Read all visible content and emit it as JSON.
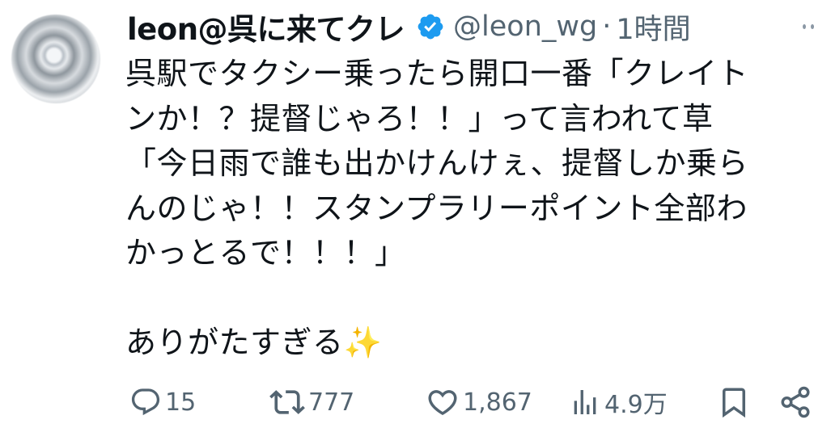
{
  "user": {
    "display_name": "leon@呉に来てクレ",
    "handle": "@leon_wg",
    "separator": "·",
    "time": "1時間"
  },
  "tweet": {
    "lines": [
      "呉駅でタクシー乗ったら開口一番「クレイト",
      "ンか！？提督じゃろ！！」って言われて草",
      "「今日雨で誰も出かけんけぇ、提督しか乗ら",
      "んのじゃ！！スタンプラリーポイント全部わ",
      "かっとるで！！！」",
      "",
      "ありがたすぎる✨"
    ]
  },
  "actions": {
    "replies": "15",
    "reposts": "777",
    "likes": "1,867",
    "views": "4.9万"
  },
  "colors": {
    "text": "#0f1419",
    "secondary": "#536471",
    "verified": "#1d9bf0"
  },
  "icons": [
    "verified-badge-icon",
    "more-icon",
    "reply-icon",
    "repost-icon",
    "like-icon",
    "views-icon",
    "bookmark-icon",
    "share-icon"
  ]
}
